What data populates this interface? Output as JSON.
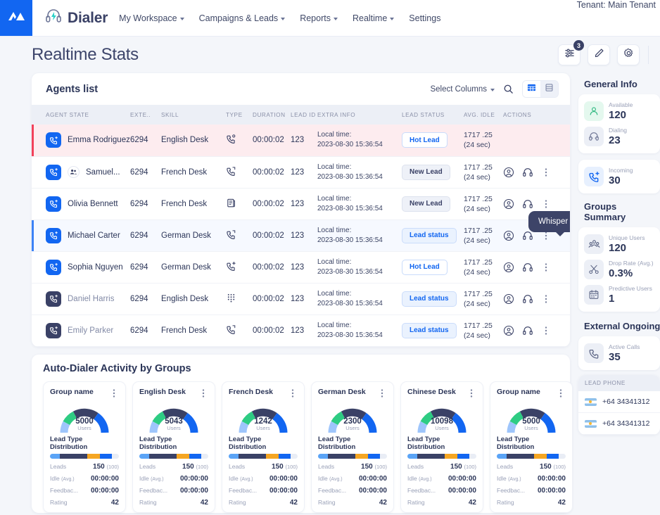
{
  "nav": {
    "brand": "Dialer",
    "logo_icon": "mountain-logo-icon",
    "headset_icon": "headset-bolt-icon",
    "links": [
      {
        "label": "My Workspace",
        "has_caret": true
      },
      {
        "label": "Campaigns & Leads",
        "has_caret": true
      },
      {
        "label": "Reports",
        "has_caret": true
      },
      {
        "label": "Realtime",
        "has_caret": true
      },
      {
        "label": "Settings",
        "has_caret": false
      }
    ],
    "tenant": "Tenant: Main Tenant"
  },
  "page": {
    "title": "Realtime Stats",
    "tools": [
      {
        "name": "filter-sliders-button",
        "icon": "sliders-icon",
        "badge": "3"
      },
      {
        "name": "edit-button",
        "icon": "pencil-icon",
        "badge": ""
      },
      {
        "name": "settings-button",
        "icon": "gear-icon",
        "badge": ""
      }
    ]
  },
  "agents": {
    "title": "Agents list",
    "select_columns": "Select Columns",
    "search_icon": "search-icon",
    "view_grid_icon": "grid-view-icon",
    "view_list_icon": "list-view-icon",
    "columns": [
      "AGENT STATE",
      "EXTE..",
      "SKILL",
      "TYPE",
      "DURATION",
      "LEAD ID",
      "EXTRA INFO",
      "LEAD STATUS",
      "AVG. IDLE",
      "ACTIONS"
    ],
    "tooltip": "Whisper call",
    "rows": [
      {
        "name": "Emma Rodriguez",
        "ext": "6294",
        "skill": "English Desk",
        "type_icon": "phone-outgoing-icon",
        "duration": "00:00:02",
        "lead_id": "123",
        "extra_label": "Local time:",
        "extra_value": "2023-08-30 15:36:54",
        "status": "Hot Lead",
        "status_kind": "hot",
        "idle_top": "1717 .25",
        "idle_bottom": "(24 sec)",
        "row_kind": "hot",
        "state_kind": "blue",
        "muted": false,
        "group": false,
        "show_actions": false
      },
      {
        "name": "Samuel...",
        "ext": "6294",
        "skill": "French Desk",
        "type_icon": "phone-forward-icon",
        "duration": "00:00:02",
        "lead_id": "123",
        "extra_label": "Local time:",
        "extra_value": "2023-08-30 15:36:54",
        "status": "New Lead",
        "status_kind": "new",
        "idle_top": "1717 .25",
        "idle_bottom": "(24 sec)",
        "row_kind": "plain",
        "state_kind": "blue",
        "muted": false,
        "group": true,
        "show_actions": true
      },
      {
        "name": "Olivia Bennett",
        "ext": "6294",
        "skill": "French Desk",
        "type_icon": "document-icon",
        "duration": "00:00:02",
        "lead_id": "123",
        "extra_label": "Local time:",
        "extra_value": "2023-08-30 15:36:54",
        "status": "New Lead",
        "status_kind": "new",
        "idle_top": "1717 .25",
        "idle_bottom": "(24 sec)",
        "row_kind": "plain",
        "state_kind": "blue",
        "muted": false,
        "group": false,
        "show_actions": true
      },
      {
        "name": "Michael Carter",
        "ext": "6294",
        "skill": "German Desk",
        "type_icon": "phone-forward-icon",
        "duration": "00:00:02",
        "lead_id": "123",
        "extra_label": "Local time:",
        "extra_value": "2023-08-30 15:36:54",
        "status": "Lead status",
        "status_kind": "ls",
        "idle_top": "1717 .25",
        "idle_bottom": "(24 sec)",
        "row_kind": "sel",
        "state_kind": "blue",
        "muted": false,
        "group": false,
        "show_actions": true
      },
      {
        "name": "Sophia Nguyen",
        "ext": "6294",
        "skill": "German Desk",
        "type_icon": "phone-plus-icon",
        "duration": "00:00:02",
        "lead_id": "123",
        "extra_label": "Local time:",
        "extra_value": "2023-08-30 15:36:54",
        "status": "Hot Lead",
        "status_kind": "hot",
        "idle_top": "1717 .25",
        "idle_bottom": "(24 sec)",
        "row_kind": "plain",
        "state_kind": "blue",
        "muted": false,
        "group": false,
        "show_actions": true
      },
      {
        "name": "Daniel Harris",
        "ext": "6294",
        "skill": "English Desk",
        "type_icon": "dialpad-icon",
        "duration": "00:00:02",
        "lead_id": "123",
        "extra_label": "Local time:",
        "extra_value": "2023-08-30 15:36:54",
        "status": "Lead status",
        "status_kind": "ls",
        "idle_top": "1717 .25",
        "idle_bottom": "(24 sec)",
        "row_kind": "plain",
        "state_kind": "navy",
        "muted": true,
        "group": false,
        "show_actions": true
      },
      {
        "name": "Emily Parker",
        "ext": "6294",
        "skill": "French Desk",
        "type_icon": "phone-forward-icon",
        "duration": "00:00:02",
        "lead_id": "123",
        "extra_label": "Local time:",
        "extra_value": "2023-08-30 15:36:54",
        "status": "Lead status",
        "status_kind": "ls",
        "idle_top": "1717 .25",
        "idle_bottom": "(24 sec)",
        "row_kind": "plain",
        "state_kind": "navy",
        "muted": true,
        "group": false,
        "show_actions": true
      }
    ],
    "action_icons": [
      "user-circle-icon",
      "headset-icon",
      "more-vertical-icon"
    ]
  },
  "groups": {
    "title": "Auto-Dialer Activity by Groups",
    "distribution_label": "Lead Type Distribution",
    "rows_labels": {
      "leads": "Leads",
      "idle": "Idle",
      "idle_sub": "(Avg.)",
      "feedback": "Feedbac...",
      "rating": "Rating"
    },
    "cards": [
      {
        "name": "Group name",
        "gauge_value": "5000",
        "gauge_unit": "Users",
        "leads": "150",
        "leads_paren": "(100)",
        "idle": "00:00:00",
        "feedback": "00:00:00",
        "rating": "42"
      },
      {
        "name": "English Desk",
        "gauge_value": "5043",
        "gauge_unit": "Users",
        "leads": "150",
        "leads_paren": "(100)",
        "idle": "00:00:00",
        "feedback": "00:00:00",
        "rating": "42"
      },
      {
        "name": "French Desk",
        "gauge_value": "1242",
        "gauge_unit": "Users",
        "leads": "150",
        "leads_paren": "(100)",
        "idle": "00:00:00",
        "feedback": "00:00:00",
        "rating": "42"
      },
      {
        "name": "German Desk",
        "gauge_value": "2300",
        "gauge_unit": "Users",
        "leads": "150",
        "leads_paren": "(100)",
        "idle": "00:00:00",
        "feedback": "00:00:00",
        "rating": "42"
      },
      {
        "name": "Chinese Desk",
        "gauge_value": "10098",
        "gauge_unit": "Users",
        "leads": "150",
        "leads_paren": "(100)",
        "idle": "00:00:00",
        "feedback": "00:00:00",
        "rating": "42"
      },
      {
        "name": "Group name",
        "gauge_value": "5000",
        "gauge_unit": "Users",
        "leads": "150",
        "leads_paren": "(100)",
        "idle": "00:00:00",
        "feedback": "00:00:00",
        "rating": "42"
      }
    ]
  },
  "sidebar": {
    "general_info_title": "General Info",
    "general_info": [
      {
        "label": "Available",
        "value": "120",
        "icon": "user-outline-icon",
        "tone": "green"
      },
      {
        "label": "Dialing",
        "value": "23",
        "icon": "headset-icon",
        "tone": "gray"
      },
      {
        "label": "Incoming",
        "value": "30",
        "icon": "phone-incoming-icon",
        "tone": "blue"
      }
    ],
    "groups_summary_title": "Groups Summary",
    "groups_summary": [
      {
        "label": "Unique Users",
        "value": "120",
        "icon": "users-group-icon",
        "tone": "gray"
      },
      {
        "label": "Drop Rate (Avg.)",
        "value": "0.3%",
        "icon": "scissors-icon",
        "tone": "gray"
      },
      {
        "label": "Predictive Users",
        "value": "1",
        "icon": "calendar-icon",
        "tone": "gray"
      }
    ],
    "external_title": "External Ongoing",
    "external": [
      {
        "label": "Active Calls",
        "value": "35",
        "icon": "phone-icon",
        "tone": "gray"
      }
    ],
    "lead_phone_header": "LEAD PHONE",
    "lead_phones": [
      "+64 34341312",
      "+64 34341312"
    ]
  },
  "colors": {
    "accent": "#1266f1",
    "navy": "#3a4166",
    "hot_row": "#fdecef",
    "hot_bar": "#f2415a",
    "green": "#2ecc83",
    "orange": "#f5a623"
  }
}
